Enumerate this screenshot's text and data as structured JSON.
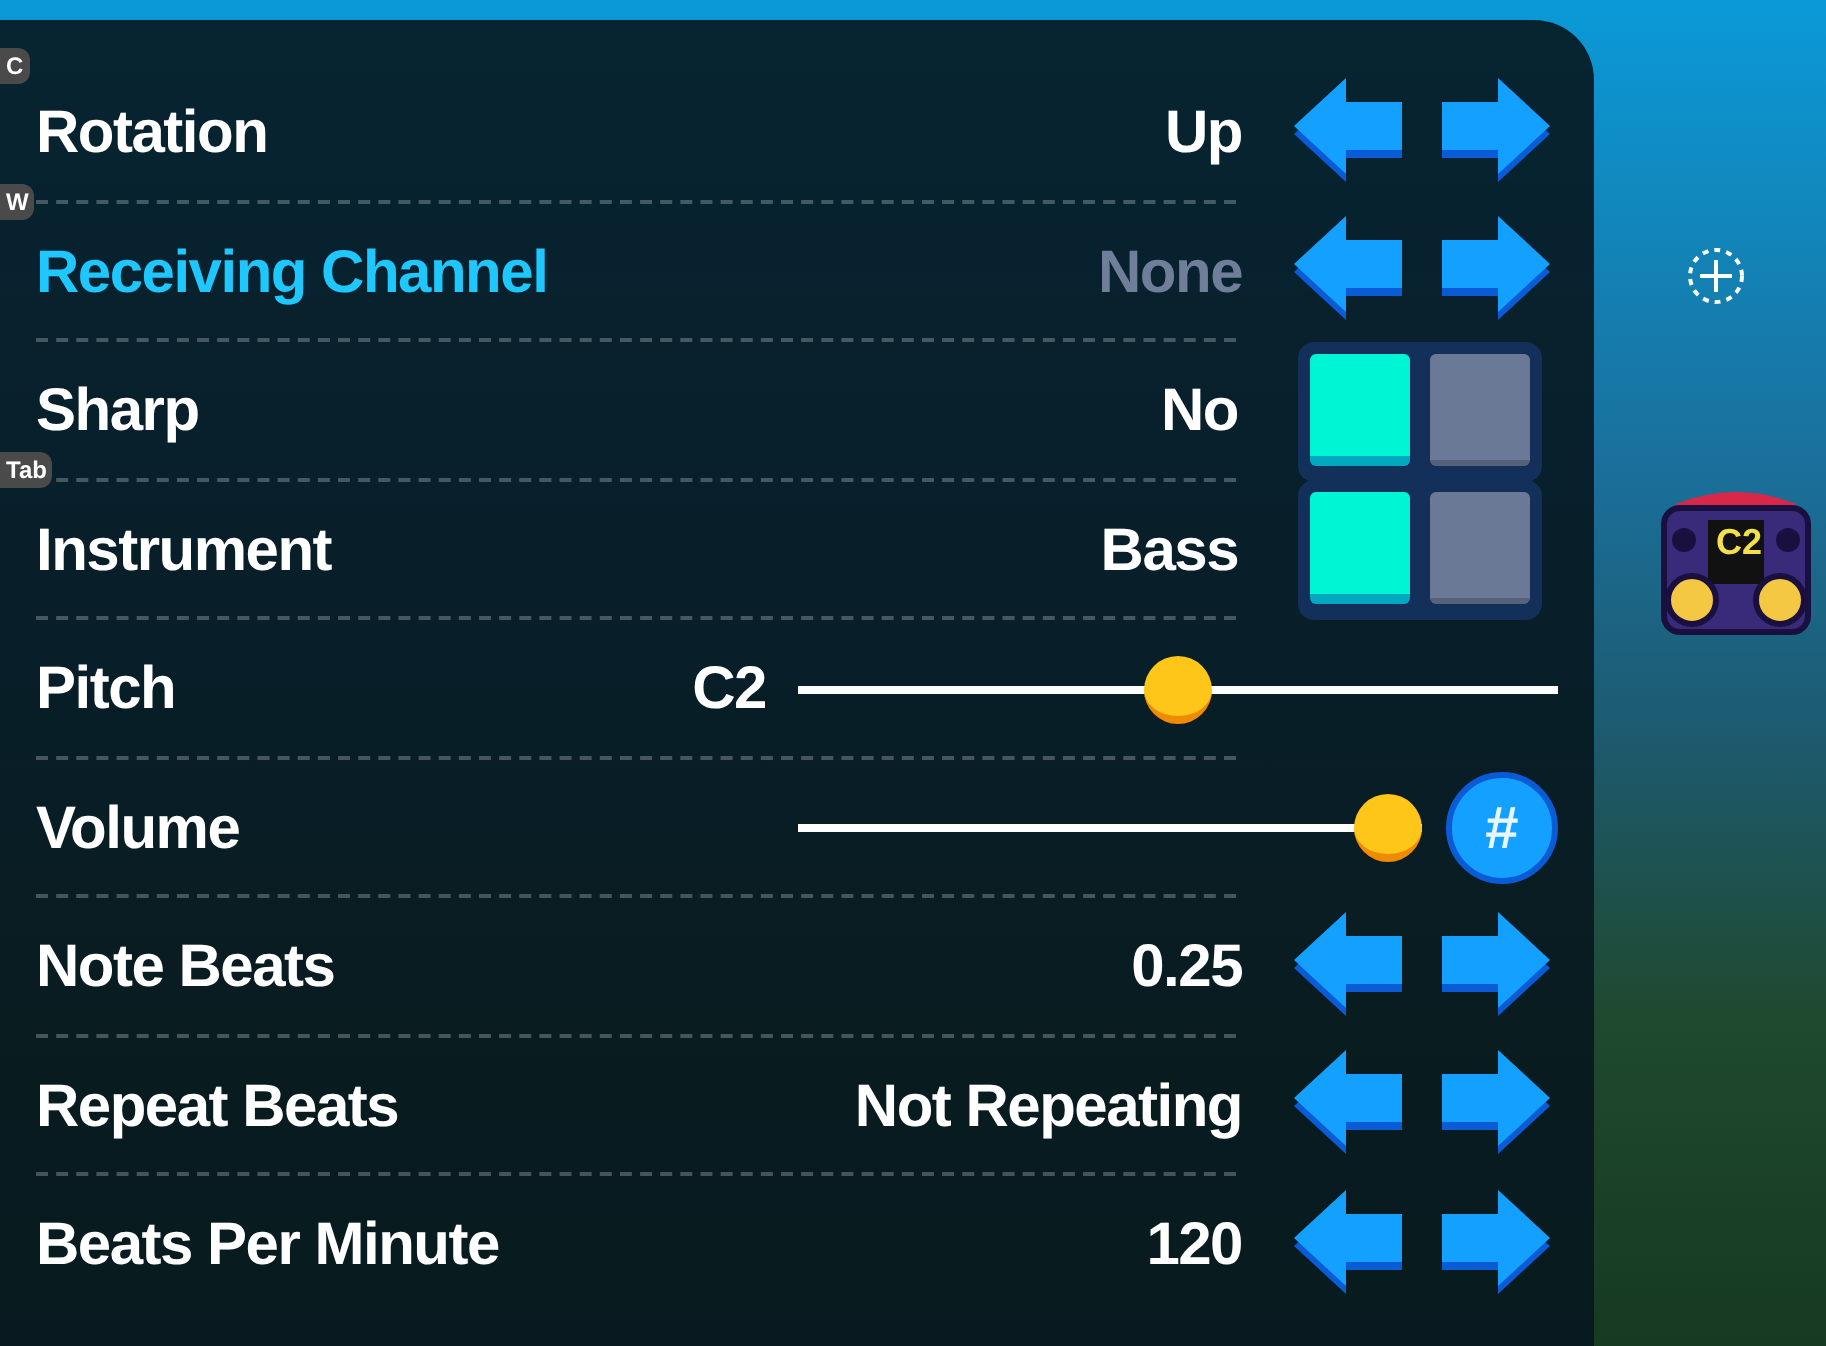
{
  "key_hints": [
    "C",
    "W",
    "Tab"
  ],
  "boombox": {
    "label": "C2"
  },
  "settings": [
    {
      "kind": "arrows",
      "label": "Rotation",
      "value": "Up",
      "selected": false
    },
    {
      "kind": "arrows",
      "label": "Receiving Channel",
      "value": "None",
      "selected": true,
      "disabled": true
    },
    {
      "kind": "toggle",
      "label": "Sharp",
      "value": "No",
      "selected": false,
      "options": [
        {
          "selected": true
        },
        {
          "selected": false
        }
      ]
    },
    {
      "kind": "toggle",
      "label": "Instrument",
      "value": "Bass",
      "selected": false,
      "options": [
        {
          "selected": true
        },
        {
          "selected": false
        }
      ]
    },
    {
      "kind": "slider",
      "label": "Pitch",
      "value": "C2",
      "selected": false,
      "level": 0.5
    },
    {
      "kind": "slider",
      "label": "Volume",
      "selected": false,
      "level": 1.0,
      "button_label": "#"
    },
    {
      "kind": "arrows",
      "label": "Note Beats",
      "value": "0.25",
      "selected": false
    },
    {
      "kind": "arrows",
      "label": "Repeat Beats",
      "value": "Not Repeating",
      "selected": false
    },
    {
      "kind": "arrows",
      "label": "Beats Per Minute",
      "value": "120",
      "selected": false
    }
  ]
}
